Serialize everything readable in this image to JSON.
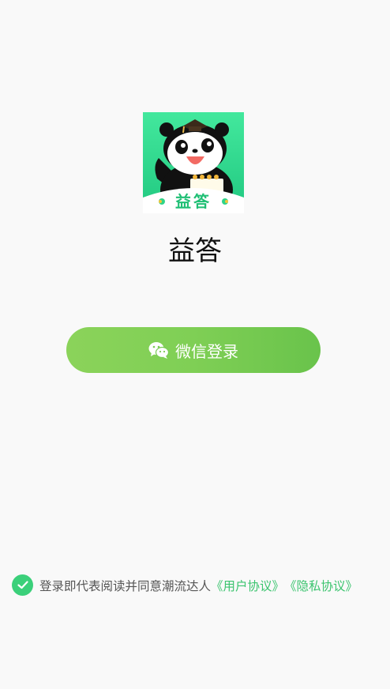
{
  "app": {
    "name": "益答",
    "logo_text": "益答"
  },
  "login": {
    "wechat_label": "微信登录"
  },
  "agreement": {
    "checked": true,
    "text": "登录即代表阅读并同意潮流达人",
    "user_agreement": "《用户协议》",
    "privacy_policy": "《隐私协议》"
  },
  "colors": {
    "background": "#f9f9f9",
    "button_start": "#8bd35a",
    "button_end": "#69c34b",
    "link": "#3cc46f",
    "check": "#3bd07a",
    "logo_green": "#2fd489"
  },
  "icons": {
    "logo": "panda-mascot-icon",
    "wechat": "wechat-icon",
    "check": "check-icon"
  }
}
